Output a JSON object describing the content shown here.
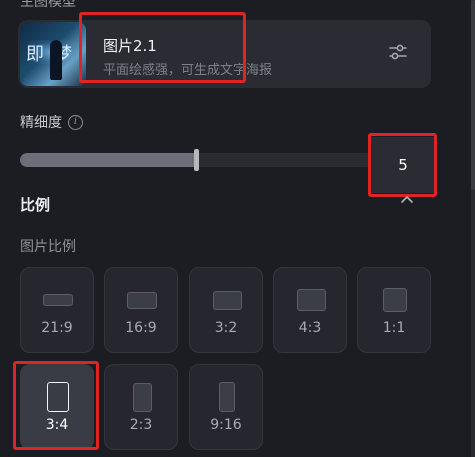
{
  "top_section_title": "主图模型",
  "model": {
    "name": "图片2.1",
    "description": "平面绘感强，可生成文字海报",
    "thumb_text": "即梦",
    "settings_icon": "sliders-icon"
  },
  "precision": {
    "label": "精细度",
    "info_icon": "info-icon",
    "value": "5",
    "fill_fraction": 0.5
  },
  "ratio": {
    "heading": "比例",
    "collapse_icon": "chevron-up-icon",
    "sublabel": "图片比例",
    "selected": "3:4",
    "options": [
      {
        "label": "21:9"
      },
      {
        "label": "16:9"
      },
      {
        "label": "3:2"
      },
      {
        "label": "4:3"
      },
      {
        "label": "1:1"
      },
      {
        "label": "3:4"
      },
      {
        "label": "2:3"
      },
      {
        "label": "9:16"
      }
    ]
  },
  "colors": {
    "background": "#1c1d22",
    "card": "#2b2c33",
    "highlight": "#e02323"
  }
}
